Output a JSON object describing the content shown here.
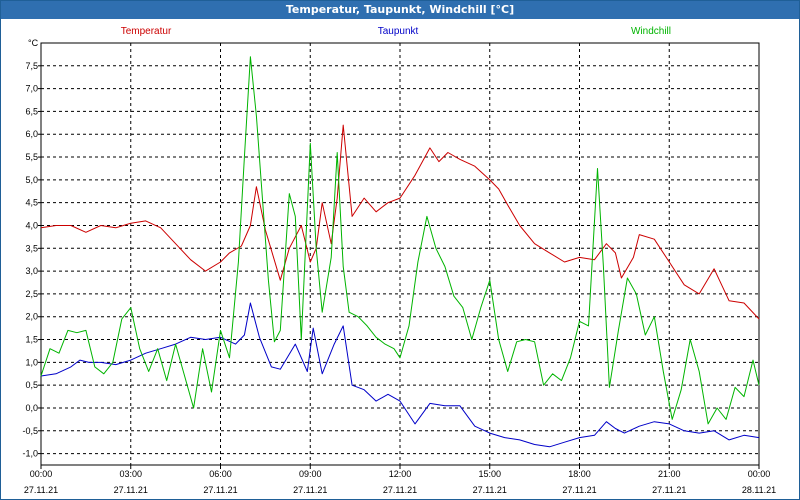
{
  "window": {
    "title": "Temperatur, Taupunkt, Windchill [°C]"
  },
  "chart_data": {
    "type": "line",
    "ylabel": "°C",
    "ylim": [
      -1.25,
      8.0
    ],
    "grid": true,
    "yticks": [
      -1.0,
      -0.5,
      0.0,
      0.5,
      1.0,
      1.5,
      2.0,
      2.5,
      3.0,
      3.5,
      4.0,
      4.5,
      5.0,
      5.5,
      6.0,
      6.5,
      7.0,
      7.5
    ],
    "ytick_labels": [
      "-1,0",
      "-0,5",
      "0,0",
      "0,5",
      "1,0",
      "1,5",
      "2,0",
      "2,5",
      "3,0",
      "3,5",
      "4,0",
      "4,5",
      "5,0",
      "5,5",
      "6,0",
      "6,5",
      "7,0",
      "7,5"
    ],
    "xlim": [
      0,
      24
    ],
    "xticks": [
      0,
      3,
      6,
      9,
      12,
      15,
      18,
      21,
      24
    ],
    "xtick_labels": [
      {
        "time": "00:00",
        "date": "27.11.21"
      },
      {
        "time": "03:00",
        "date": "27.11.21"
      },
      {
        "time": "06:00",
        "date": "27.11.21"
      },
      {
        "time": "09:00",
        "date": "27.11.21"
      },
      {
        "time": "12:00",
        "date": "27.11.21"
      },
      {
        "time": "15:00",
        "date": "27.11.21"
      },
      {
        "time": "18:00",
        "date": "27.11.21"
      },
      {
        "time": "21:00",
        "date": "27.11.21"
      },
      {
        "time": "00:00",
        "date": "28.11.21"
      }
    ],
    "series": [
      {
        "name": "Temperatur",
        "color": "#cc0000",
        "points": [
          [
            0.0,
            3.95
          ],
          [
            0.5,
            4.0
          ],
          [
            1.0,
            4.0
          ],
          [
            1.5,
            3.85
          ],
          [
            2.0,
            4.0
          ],
          [
            2.5,
            3.95
          ],
          [
            3.0,
            4.05
          ],
          [
            3.5,
            4.1
          ],
          [
            4.0,
            3.95
          ],
          [
            4.5,
            3.6
          ],
          [
            5.0,
            3.25
          ],
          [
            5.5,
            3.0
          ],
          [
            6.0,
            3.2
          ],
          [
            6.3,
            3.4
          ],
          [
            6.7,
            3.55
          ],
          [
            7.0,
            4.0
          ],
          [
            7.2,
            4.85
          ],
          [
            7.5,
            3.9
          ],
          [
            8.0,
            2.8
          ],
          [
            8.3,
            3.5
          ],
          [
            8.7,
            4.0
          ],
          [
            9.0,
            3.2
          ],
          [
            9.2,
            3.5
          ],
          [
            9.4,
            4.5
          ],
          [
            9.7,
            3.6
          ],
          [
            9.9,
            4.6
          ],
          [
            10.1,
            6.2
          ],
          [
            10.4,
            4.2
          ],
          [
            10.8,
            4.6
          ],
          [
            11.2,
            4.3
          ],
          [
            11.6,
            4.5
          ],
          [
            12.0,
            4.6
          ],
          [
            12.5,
            5.1
          ],
          [
            13.0,
            5.7
          ],
          [
            13.3,
            5.4
          ],
          [
            13.6,
            5.6
          ],
          [
            14.0,
            5.45
          ],
          [
            14.5,
            5.3
          ],
          [
            15.0,
            5.0
          ],
          [
            15.3,
            4.8
          ],
          [
            15.6,
            4.45
          ],
          [
            16.0,
            4.0
          ],
          [
            16.5,
            3.6
          ],
          [
            17.0,
            3.4
          ],
          [
            17.5,
            3.2
          ],
          [
            18.0,
            3.3
          ],
          [
            18.5,
            3.25
          ],
          [
            18.9,
            3.6
          ],
          [
            19.2,
            3.4
          ],
          [
            19.4,
            2.85
          ],
          [
            19.8,
            3.3
          ],
          [
            20.0,
            3.8
          ],
          [
            20.5,
            3.7
          ],
          [
            21.0,
            3.2
          ],
          [
            21.5,
            2.7
          ],
          [
            22.0,
            2.5
          ],
          [
            22.5,
            3.05
          ],
          [
            23.0,
            2.35
          ],
          [
            23.5,
            2.3
          ],
          [
            24.0,
            1.95
          ]
        ]
      },
      {
        "name": "Taupunkt",
        "color": "#0000c8",
        "points": [
          [
            0.0,
            0.7
          ],
          [
            0.5,
            0.75
          ],
          [
            1.0,
            0.9
          ],
          [
            1.3,
            1.05
          ],
          [
            1.6,
            1.0
          ],
          [
            2.0,
            1.0
          ],
          [
            2.5,
            0.95
          ],
          [
            3.0,
            1.05
          ],
          [
            3.5,
            1.2
          ],
          [
            4.0,
            1.3
          ],
          [
            4.5,
            1.4
          ],
          [
            5.0,
            1.55
          ],
          [
            5.5,
            1.5
          ],
          [
            6.0,
            1.55
          ],
          [
            6.5,
            1.4
          ],
          [
            6.8,
            1.6
          ],
          [
            7.0,
            2.3
          ],
          [
            7.3,
            1.55
          ],
          [
            7.7,
            0.9
          ],
          [
            8.0,
            0.85
          ],
          [
            8.5,
            1.4
          ],
          [
            8.9,
            0.8
          ],
          [
            9.1,
            1.75
          ],
          [
            9.4,
            0.75
          ],
          [
            9.8,
            1.4
          ],
          [
            10.1,
            1.8
          ],
          [
            10.4,
            0.5
          ],
          [
            10.8,
            0.4
          ],
          [
            11.2,
            0.15
          ],
          [
            11.6,
            0.3
          ],
          [
            12.0,
            0.15
          ],
          [
            12.5,
            -0.35
          ],
          [
            13.0,
            0.1
          ],
          [
            13.5,
            0.05
          ],
          [
            14.0,
            0.05
          ],
          [
            14.5,
            -0.4
          ],
          [
            15.0,
            -0.55
          ],
          [
            15.5,
            -0.65
          ],
          [
            16.0,
            -0.7
          ],
          [
            16.5,
            -0.8
          ],
          [
            17.0,
            -0.85
          ],
          [
            17.5,
            -0.75
          ],
          [
            18.0,
            -0.65
          ],
          [
            18.5,
            -0.6
          ],
          [
            18.9,
            -0.3
          ],
          [
            19.2,
            -0.45
          ],
          [
            19.5,
            -0.55
          ],
          [
            20.0,
            -0.4
          ],
          [
            20.5,
            -0.3
          ],
          [
            21.0,
            -0.35
          ],
          [
            21.5,
            -0.5
          ],
          [
            22.0,
            -0.55
          ],
          [
            22.5,
            -0.5
          ],
          [
            23.0,
            -0.7
          ],
          [
            23.5,
            -0.6
          ],
          [
            24.0,
            -0.65
          ]
        ]
      },
      {
        "name": "Windchill",
        "color": "#00b400",
        "points": [
          [
            0.0,
            0.7
          ],
          [
            0.3,
            1.3
          ],
          [
            0.6,
            1.2
          ],
          [
            0.9,
            1.7
          ],
          [
            1.2,
            1.65
          ],
          [
            1.5,
            1.7
          ],
          [
            1.8,
            0.9
          ],
          [
            2.1,
            0.75
          ],
          [
            2.4,
            1.0
          ],
          [
            2.7,
            1.95
          ],
          [
            3.0,
            2.2
          ],
          [
            3.3,
            1.3
          ],
          [
            3.6,
            0.8
          ],
          [
            3.9,
            1.3
          ],
          [
            4.2,
            0.6
          ],
          [
            4.5,
            1.4
          ],
          [
            4.8,
            0.7
          ],
          [
            5.1,
            0.0
          ],
          [
            5.4,
            1.3
          ],
          [
            5.7,
            0.35
          ],
          [
            6.0,
            1.7
          ],
          [
            6.3,
            1.1
          ],
          [
            6.6,
            3.2
          ],
          [
            6.8,
            5.5
          ],
          [
            7.0,
            7.7
          ],
          [
            7.2,
            6.4
          ],
          [
            7.4,
            4.6
          ],
          [
            7.6,
            2.8
          ],
          [
            7.8,
            1.45
          ],
          [
            8.0,
            1.7
          ],
          [
            8.3,
            4.7
          ],
          [
            8.5,
            4.2
          ],
          [
            8.7,
            1.5
          ],
          [
            9.0,
            5.8
          ],
          [
            9.2,
            3.5
          ],
          [
            9.4,
            2.1
          ],
          [
            9.7,
            3.3
          ],
          [
            9.9,
            5.6
          ],
          [
            10.1,
            3.1
          ],
          [
            10.3,
            2.1
          ],
          [
            10.6,
            2.0
          ],
          [
            10.9,
            1.8
          ],
          [
            11.2,
            1.55
          ],
          [
            11.5,
            1.4
          ],
          [
            11.8,
            1.3
          ],
          [
            12.0,
            1.1
          ],
          [
            12.3,
            1.8
          ],
          [
            12.6,
            3.2
          ],
          [
            12.9,
            4.2
          ],
          [
            13.2,
            3.5
          ],
          [
            13.5,
            3.1
          ],
          [
            13.8,
            2.45
          ],
          [
            14.1,
            2.2
          ],
          [
            14.4,
            1.5
          ],
          [
            14.7,
            2.2
          ],
          [
            15.0,
            2.8
          ],
          [
            15.3,
            1.5
          ],
          [
            15.6,
            0.8
          ],
          [
            15.9,
            1.45
          ],
          [
            16.2,
            1.5
          ],
          [
            16.5,
            1.45
          ],
          [
            16.8,
            0.5
          ],
          [
            17.1,
            0.75
          ],
          [
            17.4,
            0.6
          ],
          [
            17.7,
            1.1
          ],
          [
            18.0,
            1.9
          ],
          [
            18.3,
            1.8
          ],
          [
            18.6,
            5.25
          ],
          [
            18.8,
            3.1
          ],
          [
            19.0,
            0.45
          ],
          [
            19.3,
            1.7
          ],
          [
            19.6,
            2.85
          ],
          [
            19.9,
            2.5
          ],
          [
            20.2,
            1.6
          ],
          [
            20.5,
            2.0
          ],
          [
            20.8,
            0.8
          ],
          [
            21.1,
            -0.25
          ],
          [
            21.4,
            0.4
          ],
          [
            21.7,
            1.5
          ],
          [
            22.0,
            0.8
          ],
          [
            22.3,
            -0.35
          ],
          [
            22.6,
            0.0
          ],
          [
            22.9,
            -0.25
          ],
          [
            23.2,
            0.45
          ],
          [
            23.5,
            0.25
          ],
          [
            23.8,
            1.05
          ],
          [
            24.0,
            0.5
          ]
        ]
      }
    ]
  }
}
